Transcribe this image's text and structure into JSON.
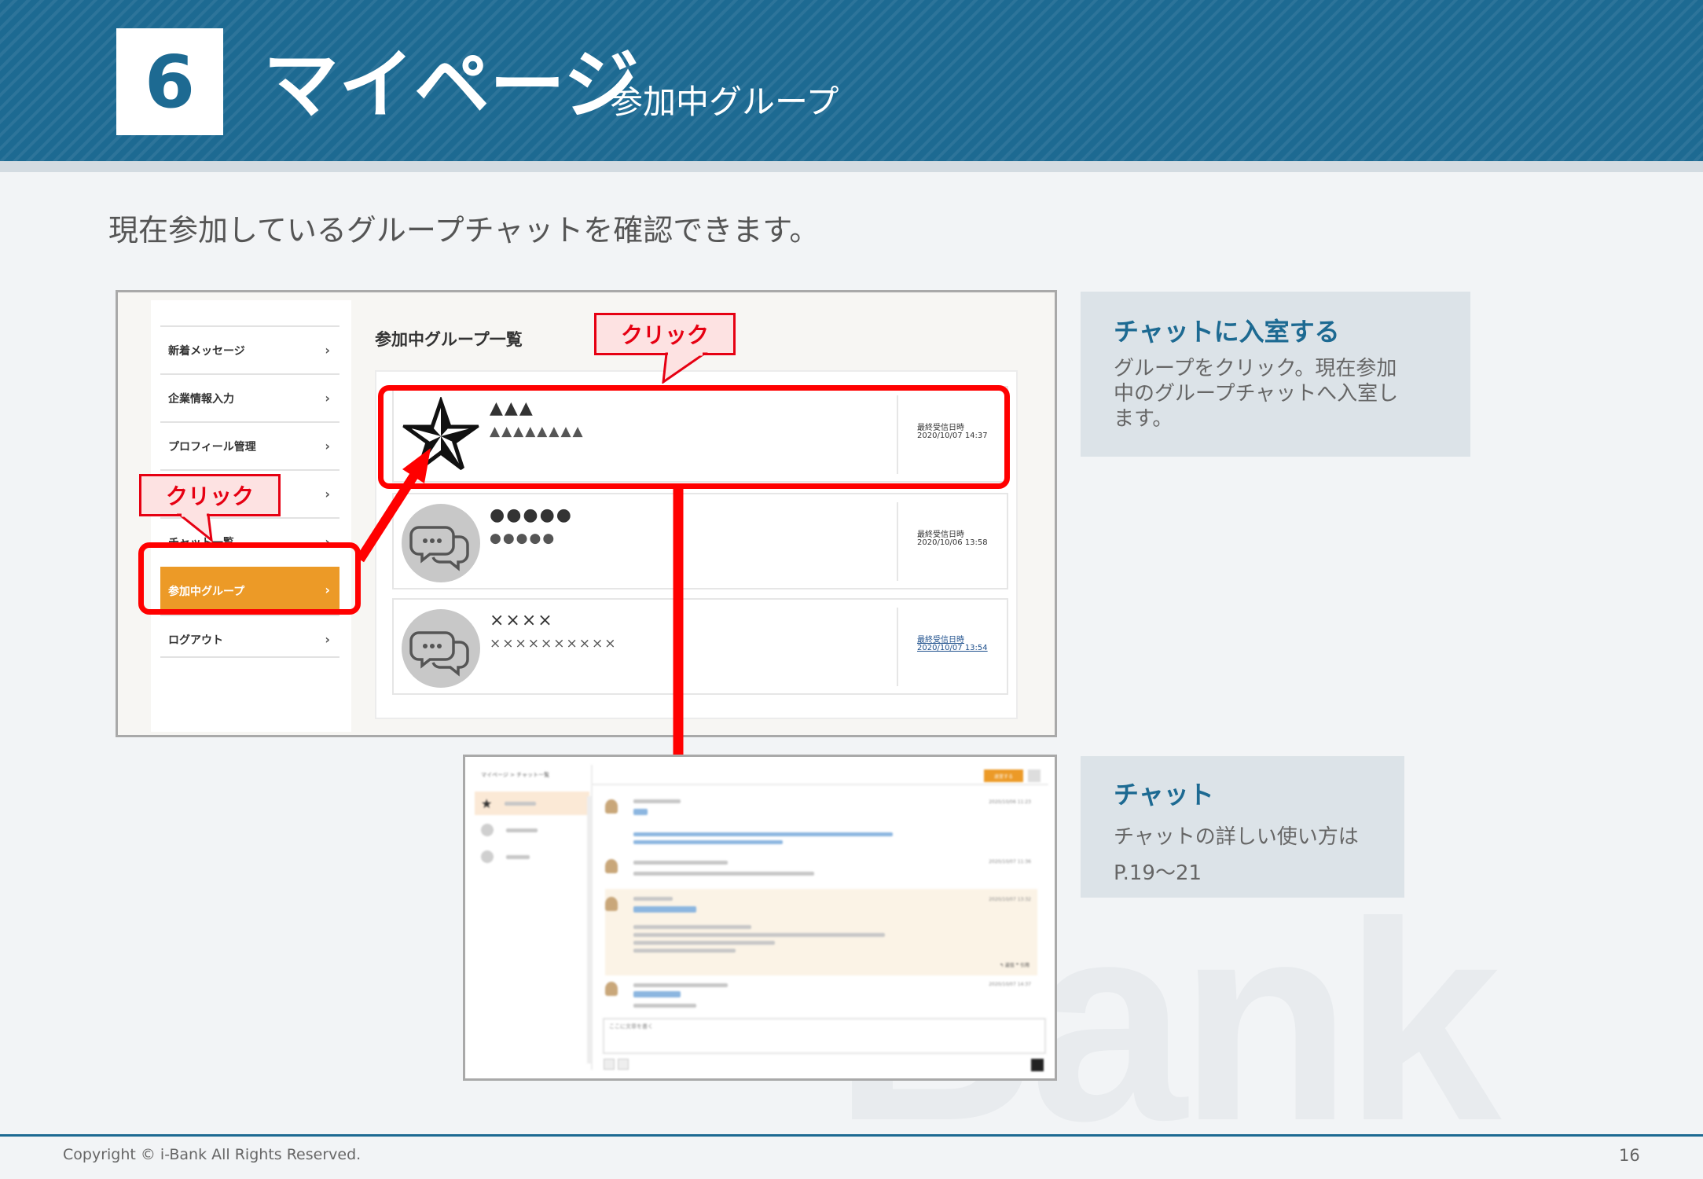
{
  "header": {
    "chapter_number": "6",
    "title": "マイページ",
    "subtitle": "参加中グループ"
  },
  "intro_text": "現在参加しているグループチャットを確認できます。",
  "watermark": "Bank",
  "screenshot1": {
    "menu_items": [
      {
        "label": "新着メッセージ"
      },
      {
        "label": "企業情報入力"
      },
      {
        "label": "プロフィール管理"
      },
      {
        "label": ""
      },
      {
        "label": "チャット一覧"
      },
      {
        "label": "参加中グループ"
      },
      {
        "label": "ログアウト"
      }
    ],
    "chevron": "›",
    "list_heading": "参加中グループ一覧",
    "groups": [
      {
        "name": "▲▲▲",
        "description": "▲▲▲▲▲▲▲▲",
        "date_label": "最終受信日時",
        "date": "2020/10/07 14:37",
        "avatar_icon": "star-icon"
      },
      {
        "name": "●●●●●",
        "description": "●●●●●",
        "date_label": "最終受信日時",
        "date": "2020/10/06 13:58",
        "avatar_icon": "chat-bubbles-icon"
      },
      {
        "name": "××××",
        "description": "××××××××××",
        "date_label": "最終受信日時",
        "date": "2020/10/07 13:54",
        "avatar_icon": "chat-bubbles-icon"
      }
    ]
  },
  "callouts": {
    "click_top": "クリック",
    "click_left": "クリック"
  },
  "screenshot2": {
    "breadcrumb": "マイページ > チャット一覧",
    "action_button": "退室する",
    "sidebar": [
      "",
      "",
      ""
    ],
    "times": [
      "2020/10/06 11:23",
      "2020/10/07 11:36",
      "2020/10/07 13:32",
      "2020/10/07 14:37"
    ],
    "reply_label": "返信",
    "quote_label": "引用",
    "input_placeholder": "ここに文章を書く"
  },
  "info_boxes": [
    {
      "title": "チャットに入室する",
      "lines": [
        "グループをクリック。現在参加",
        "中のグループチャットへ入室し",
        "ます。"
      ]
    },
    {
      "title": "チャット",
      "lines": [
        "チャットの詳しい使い方は",
        "P.19～21"
      ]
    }
  ],
  "footer": {
    "copyright": "Copyright © i-Bank All Rights Reserved.",
    "page_number": "16"
  },
  "colors": {
    "header_blue": "#1d6a92",
    "accent_red": "#ff0000",
    "menu_active_orange": "#ec9a27",
    "info_box_bg": "#dce3e8"
  }
}
